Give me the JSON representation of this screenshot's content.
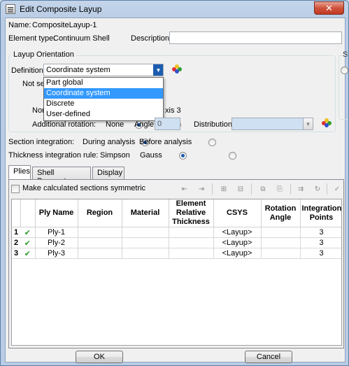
{
  "window": {
    "title": "Edit Composite Layup",
    "close_label": "✕"
  },
  "header": {
    "name_label": "Name:",
    "name_value": "CompositeLayup-1",
    "element_type_label": "Element type:",
    "element_type_value": "Continuum Shell",
    "description_label": "Description:",
    "description_value": ""
  },
  "orientation": {
    "group_title": "Layup Orientation",
    "definition_label": "Definition:",
    "definition_value": "Coordinate system",
    "dropdown_options": [
      "Part global",
      "Coordinate system",
      "Discrete",
      "User-defined"
    ],
    "selected_option": "Coordinate system",
    "partial_label_1": "Not sel",
    "partial_label_2": "Nor",
    "partial_label_3": "xis 3",
    "additional_rotation_label": "Additional rotation:",
    "rotation_options": {
      "none": "None",
      "angle": "Angle:",
      "distribution": "Distribution:"
    },
    "angle_value": "0",
    "distribution_value": ""
  },
  "section_integration": {
    "label": "Section integration:",
    "options": [
      "During analysis",
      "Before analysis"
    ],
    "selected": "During analysis"
  },
  "thickness_integration": {
    "label": "Thickness integration rule:",
    "options": [
      "Simpson",
      "Gauss"
    ],
    "selected": "Simpson"
  },
  "tabs": [
    {
      "label": "Plies",
      "active": true
    },
    {
      "label": "Shell Parameters",
      "active": false
    },
    {
      "label": "Display",
      "active": false
    }
  ],
  "plies": {
    "symmetric_label": "Make calculated sections symmetric",
    "columns": [
      "Ply Name",
      "Region",
      "Material",
      "Element Relative Thickness",
      "CSYS",
      "Rotation Angle",
      "Integration Points"
    ],
    "rows": [
      {
        "num": "1",
        "ply_name": "Ply-1",
        "region": "",
        "material": "",
        "thickness": "",
        "csys": "<Layup>",
        "rotation": "",
        "points": "3"
      },
      {
        "num": "2",
        "ply_name": "Ply-2",
        "region": "",
        "material": "",
        "thickness": "",
        "csys": "<Layup>",
        "rotation": "",
        "points": "3"
      },
      {
        "num": "3",
        "ply_name": "Ply-3",
        "region": "",
        "material": "",
        "thickness": "",
        "csys": "<Layup>",
        "rotation": "",
        "points": "3"
      }
    ],
    "check_glyph": "✔"
  },
  "footer": {
    "ok_label": "OK",
    "cancel_label": "Cancel"
  },
  "colors": {
    "selection": "#3399ff",
    "close_button": "#c23a23",
    "check": "#2a9a2a"
  }
}
